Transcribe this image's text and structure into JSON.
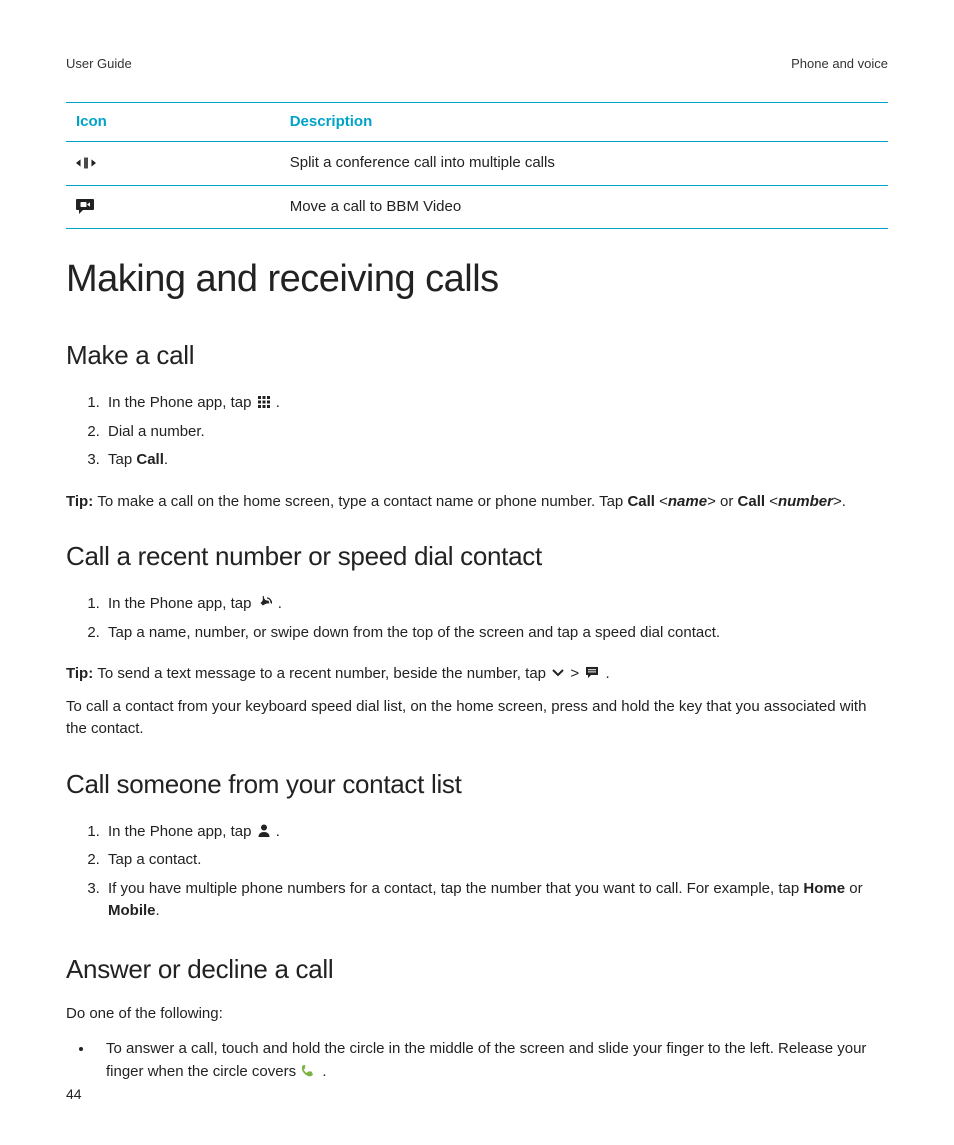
{
  "header": {
    "left": "User Guide",
    "right": "Phone and voice"
  },
  "table": {
    "th_icon": "Icon",
    "th_desc": "Description",
    "rows": [
      {
        "icon": "split-icon",
        "desc": "Split a conference call into multiple calls"
      },
      {
        "icon": "video-chat-icon",
        "desc": "Move a call to BBM Video"
      }
    ]
  },
  "h1": "Making and receiving calls",
  "sec1": {
    "heading": "Make a call",
    "step1_pre": "In the Phone app, tap ",
    "step1_post": " .",
    "step2": "Dial a number.",
    "step3_pre": "Tap ",
    "step3_bold": "Call",
    "step3_post": ".",
    "tip_label": "Tip: ",
    "tip_a": "To make a call on the home screen, type a contact name or phone number. Tap ",
    "tip_b1": "Call",
    "tip_c1": " <",
    "tip_p1": "name",
    "tip_d1": "> or ",
    "tip_b2": "Call",
    "tip_c2": " <",
    "tip_p2": "number",
    "tip_d2": ">."
  },
  "sec2": {
    "heading": "Call a recent number or speed dial contact",
    "step1_pre": "In the Phone app, tap ",
    "step1_post": " .",
    "step2": "Tap a name, number, or swipe down from the top of the screen and tap a speed dial contact.",
    "tip_label": "Tip: ",
    "tip_a": "To send a text message to a recent number, beside the number, tap ",
    "tip_sep": " > ",
    "tip_post": " .",
    "para": "To call a contact from your keyboard speed dial list, on the home screen, press and hold the key that you associated with the contact."
  },
  "sec3": {
    "heading": "Call someone from your contact list",
    "step1_pre": "In the Phone app, tap ",
    "step1_post": " .",
    "step2": "Tap a contact.",
    "step3_a": "If you have multiple phone numbers for a contact, tap the number that you want to call. For example, tap ",
    "step3_b1": "Home",
    "step3_c": " or ",
    "step3_b2": "Mobile",
    "step3_d": "."
  },
  "sec4": {
    "heading": "Answer or decline a call",
    "intro": "Do one of the following:",
    "bullet_a": "To answer a call, touch and hold the circle in the middle of the screen and slide your finger to the left. Release your finger when the circle covers ",
    "bullet_post": " ."
  },
  "page_number": "44"
}
